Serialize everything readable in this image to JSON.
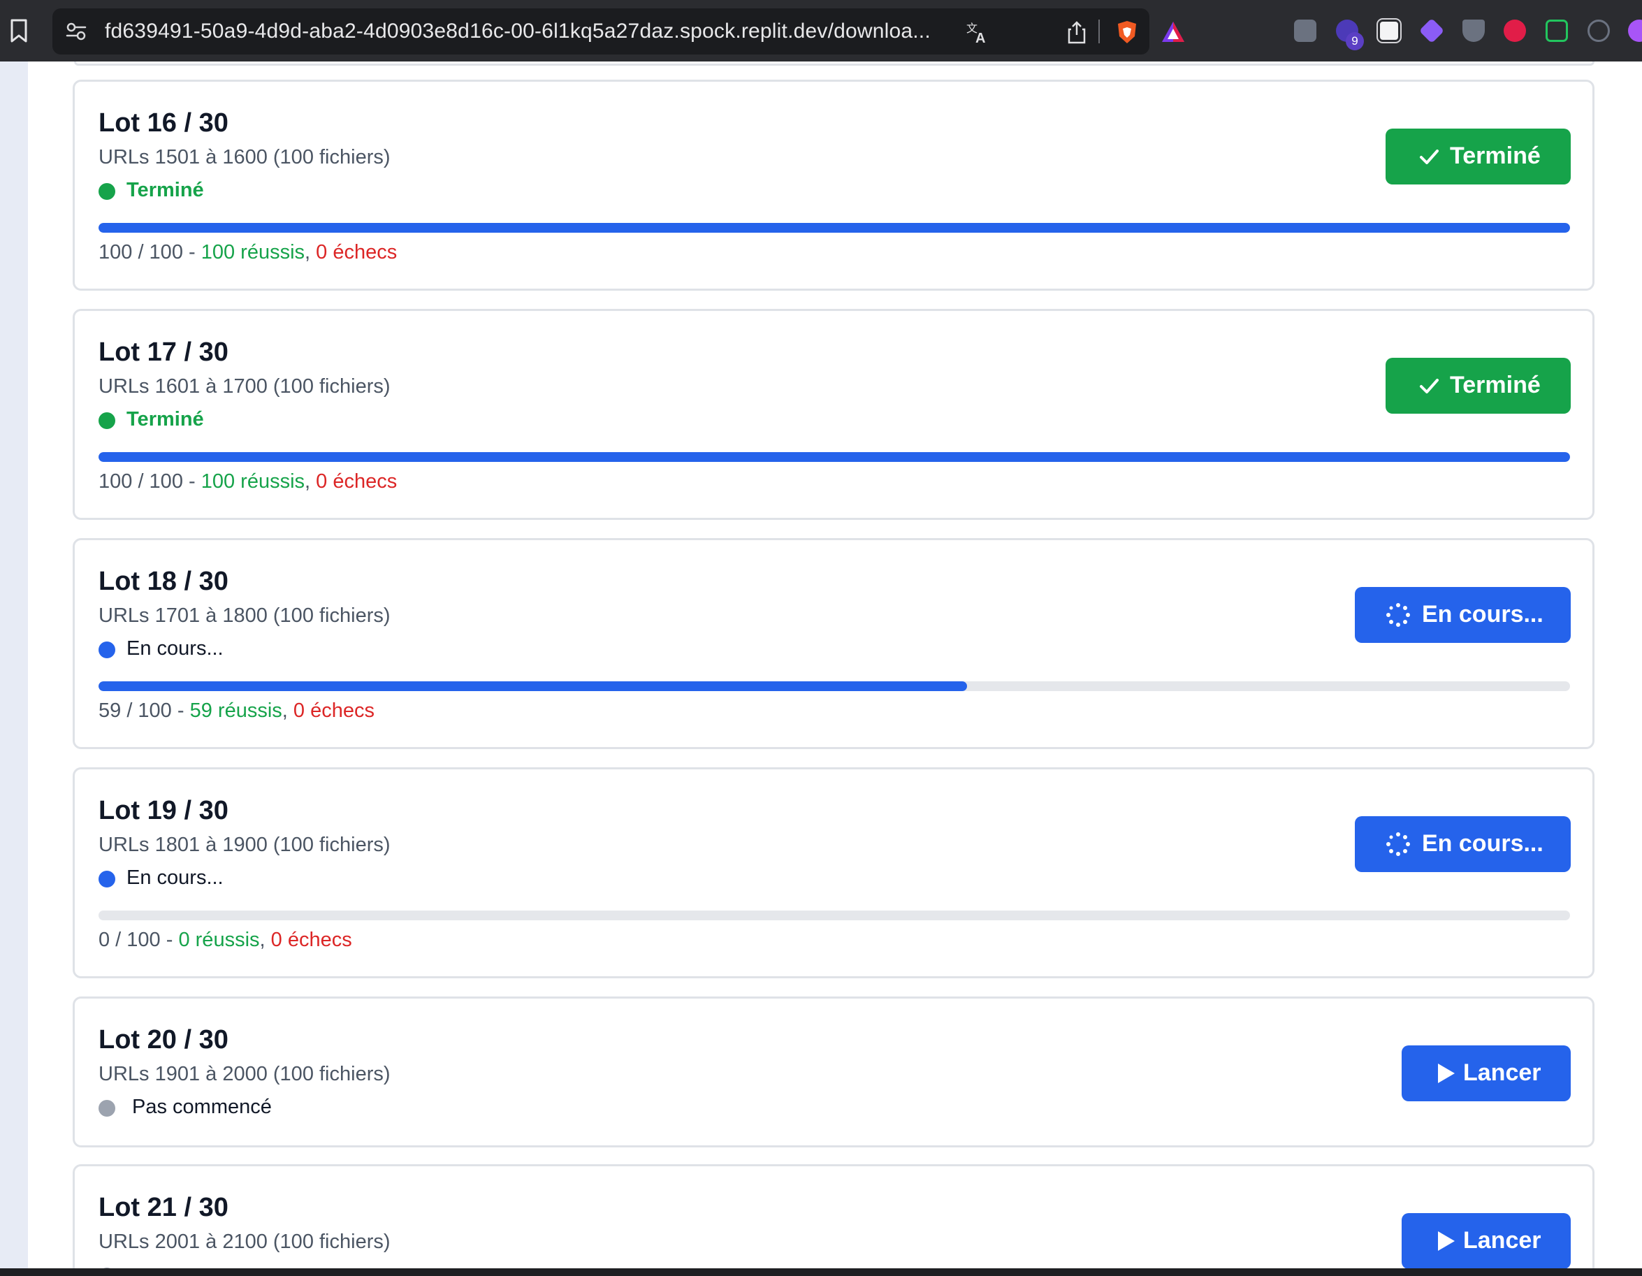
{
  "browser": {
    "url": "fd639491-50a9-4d9d-aba2-4d0903e8d16c-00-6l1kq5a27daz.spock.replit.dev/downloa...",
    "extension_badge": "9",
    "icons": [
      "bookmark-icon",
      "site-settings-icon",
      "translate-icon",
      "share-icon",
      "brave-shields-icon",
      "brave-rewards-icon"
    ]
  },
  "colors": {
    "done": "#16a34a",
    "running": "#2563eb",
    "idle": "#9ca3af",
    "fail": "#dc2626"
  },
  "lots": [
    {
      "title": "Lot 16 / 30",
      "range": "URLs 1501 à 1600 (100 fichiers)",
      "status": "Terminé",
      "progress": 1.0,
      "count": "100 / 100",
      "sep": " - ",
      "success": "100 réussis",
      "comma": ", ",
      "failures": "0 échecs",
      "button": "Terminé"
    },
    {
      "title": "Lot 17 / 30",
      "range": "URLs 1601 à 1700 (100 fichiers)",
      "status": "Terminé",
      "progress": 1.0,
      "count": "100 / 100",
      "sep": " - ",
      "success": "100 réussis",
      "comma": ", ",
      "failures": "0 échecs",
      "button": "Terminé"
    },
    {
      "title": "Lot 18 / 30",
      "range": "URLs 1701 à 1800 (100 fichiers)",
      "status": "En cours...",
      "progress": 0.59,
      "count": "59 / 100",
      "sep": " - ",
      "success": "59 réussis",
      "comma": ", ",
      "failures": "0 échecs",
      "button": "En cours..."
    },
    {
      "title": "Lot 19 / 30",
      "range": "URLs 1801 à 1900 (100 fichiers)",
      "status": "En cours...",
      "progress": 0.0,
      "count": "0 / 100",
      "sep": " - ",
      "success": "0 réussis",
      "comma": ", ",
      "failures": "0 échecs",
      "button": "En cours..."
    },
    {
      "title": "Lot 20 / 30",
      "range": "URLs 1901 à 2000 (100 fichiers)",
      "status": "Pas commencé",
      "button": "Lancer"
    },
    {
      "title": "Lot 21 / 30",
      "range": "URLs 2001 à 2100 (100 fichiers)",
      "button": "Lancer"
    }
  ]
}
